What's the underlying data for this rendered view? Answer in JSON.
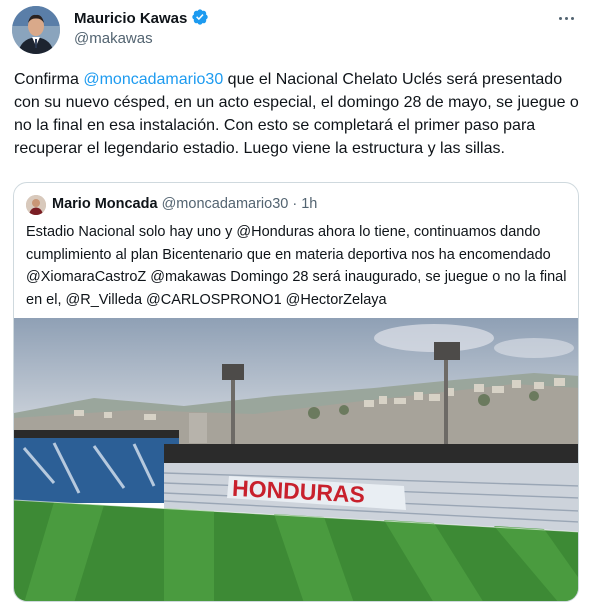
{
  "author": {
    "name": "Mauricio Kawas",
    "handle": "@makawas"
  },
  "tweet": {
    "pre": "Confirma ",
    "mention": "@moncadamario30",
    "post": " que el Nacional Chelato Uclés será presentado con su nuevo césped, en un acto especial, el domingo 28 de mayo, se juegue o no la final en esa instalación. Con esto se completará el primer paso para recuperar el legendario estadio. Luego viene la estructura y las sillas."
  },
  "quoted": {
    "name": "Mario Moncada",
    "handle": "@moncadamario30",
    "separator": " · ",
    "time": "1h",
    "text": "Estadio Nacional solo hay uno y @Honduras ahora lo tiene, continuamos dando cumplimiento al plan Bicentenario que en materia deportiva nos ha encomendado @XiomaraCastroZ  @makawas Domingo 28 será inaugurado, se juegue o no la final en el, @R_Villeda @CARLOSPRONO1 @HectorZelaya",
    "image_sign": "HONDURAS"
  },
  "icons": {
    "verified": "verified-badge-icon",
    "more": "more-options-icon"
  },
  "colors": {
    "link": "#1d9bf0",
    "secondary_text": "#536471",
    "border": "#cfd9de"
  }
}
